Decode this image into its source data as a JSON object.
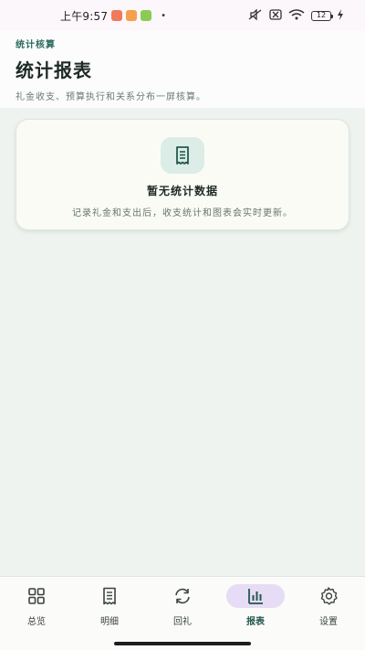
{
  "status_bar": {
    "time": "上午9:57",
    "battery_level": "12",
    "dot": "•",
    "badge_colors": [
      "#f07a5a",
      "#f6a04b",
      "#8bcb53"
    ]
  },
  "header": {
    "eyebrow": "统计核算",
    "title": "统计报表",
    "subtitle": "礼金收支、预算执行和关系分布一屏核算。"
  },
  "empty_state": {
    "icon": "receipt-icon",
    "title": "暂无统计数据",
    "description": "记录礼金和支出后，收支统计和图表会实时更新。"
  },
  "bottom_nav": {
    "active_index": 3,
    "items": [
      {
        "label": "总览",
        "icon": "grid-icon"
      },
      {
        "label": "明细",
        "icon": "receipt-icon"
      },
      {
        "label": "回礼",
        "icon": "refresh-icon"
      },
      {
        "label": "报表",
        "icon": "bar-chart-icon"
      },
      {
        "label": "设置",
        "icon": "gear-icon"
      }
    ]
  },
  "colors": {
    "accent": "#25594d",
    "active_pill": "#e6dcf5",
    "page_bg": "#eef3ef",
    "card_bg": "#fbfbf5"
  }
}
